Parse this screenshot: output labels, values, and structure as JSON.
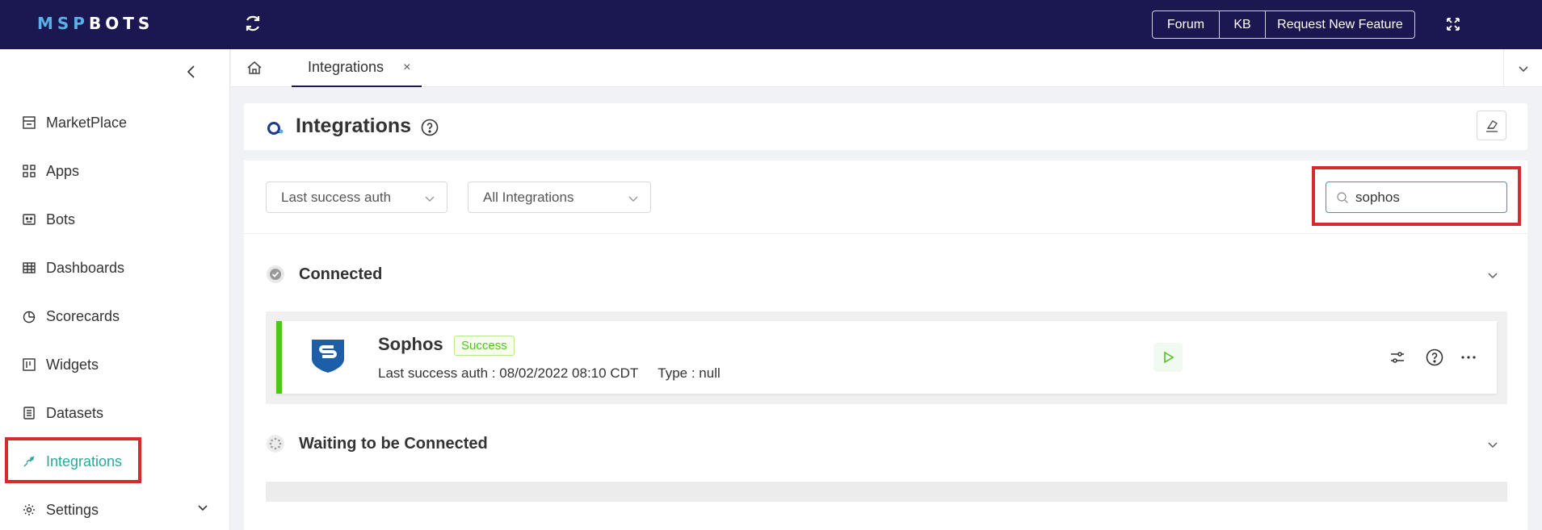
{
  "app": {
    "logo_part1": "MSP",
    "logo_part2": "BOTS"
  },
  "topbar": {
    "forum_label": "Forum",
    "kb_label": "KB",
    "request_label": "Request New Feature"
  },
  "sidebar": {
    "items": [
      {
        "label": "MarketPlace",
        "icon": "store-icon"
      },
      {
        "label": "Apps",
        "icon": "grid-icon"
      },
      {
        "label": "Bots",
        "icon": "bot-icon"
      },
      {
        "label": "Dashboards",
        "icon": "table-icon"
      },
      {
        "label": "Scorecards",
        "icon": "pie-icon"
      },
      {
        "label": "Widgets",
        "icon": "widget-icon"
      },
      {
        "label": "Datasets",
        "icon": "dataset-icon"
      },
      {
        "label": "Integrations",
        "icon": "link-icon"
      },
      {
        "label": "Settings",
        "icon": "gear-icon"
      }
    ],
    "active": "Integrations"
  },
  "tabs": {
    "active_tab_label": "Integrations",
    "close_glyph": "×"
  },
  "page": {
    "title": "Integrations"
  },
  "filters": {
    "sort_value": "Last success auth",
    "type_value": "All Integrations",
    "search_value": "sophos"
  },
  "sections": {
    "connected_label": "Connected",
    "waiting_label": "Waiting to be Connected"
  },
  "integration": {
    "name": "Sophos",
    "status": "Success",
    "last_auth": "Last success auth : 08/02/2022 08:10 CDT",
    "type": "Type : null"
  },
  "colors": {
    "topbar_bg": "#1b1750",
    "accent": "#2aa99b",
    "success": "#52c41a",
    "highlight": "#d72a2f"
  }
}
